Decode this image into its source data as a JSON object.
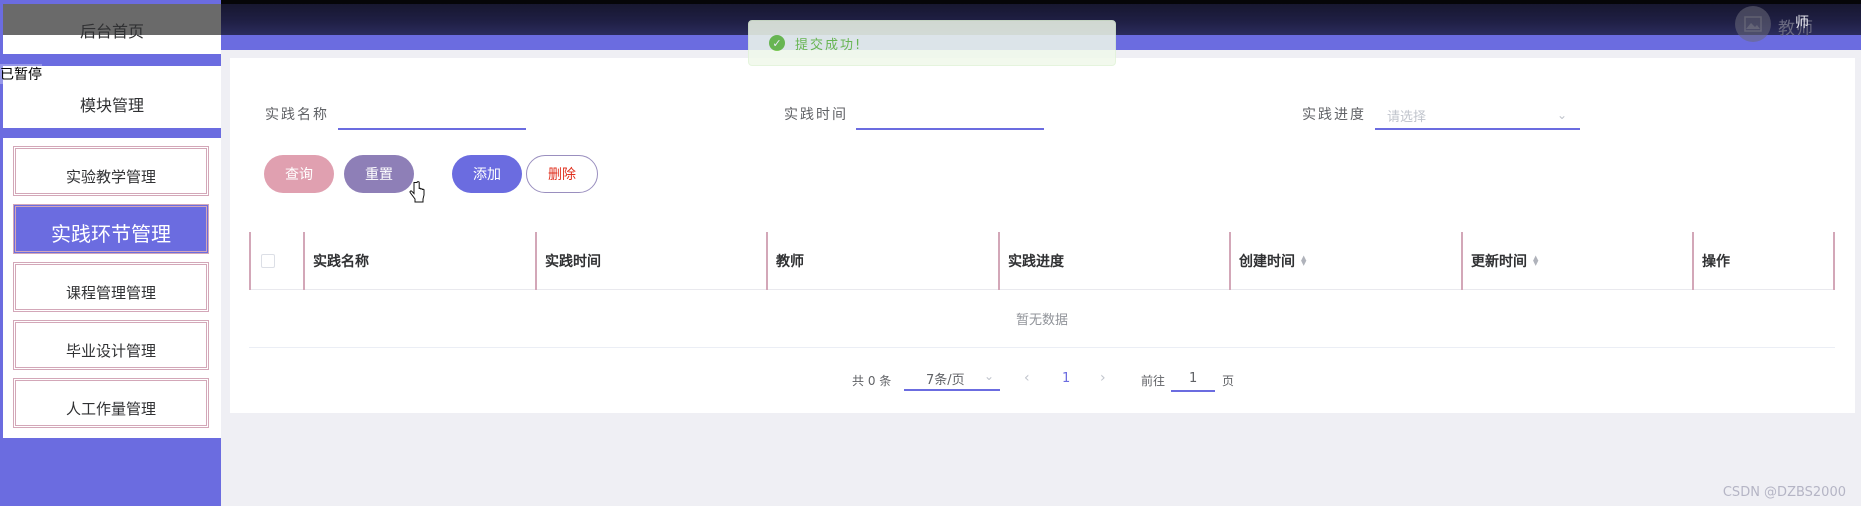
{
  "header": {
    "username": "教师",
    "role_label": "师"
  },
  "sidebar": {
    "home_label": "后台首页",
    "paused_label": "已暂停",
    "module_label": "模块管理",
    "items": [
      {
        "label": "实验教学管理",
        "active": false
      },
      {
        "label": "实践环节管理",
        "active": true
      },
      {
        "label": "课程管理管理",
        "active": false
      },
      {
        "label": "毕业设计管理",
        "active": false
      },
      {
        "label": "人工作量管理",
        "active": false
      }
    ]
  },
  "toast": {
    "message": "提交成功!"
  },
  "search": {
    "name_label": "实践名称",
    "time_label": "实践时间",
    "progress_label": "实践进度",
    "progress_placeholder": "请选择"
  },
  "buttons": {
    "query": "查询",
    "reset": "重置",
    "add": "添加",
    "delete": "删除"
  },
  "table": {
    "columns": [
      "实践名称",
      "实践时间",
      "教师",
      "实践进度",
      "创建时间",
      "更新时间",
      "操作"
    ],
    "empty_text": "暂无数据"
  },
  "pager": {
    "total": "共 0 条",
    "page_size": "7条/页",
    "current_page": "1",
    "goto_label": "前往",
    "goto_value": "1",
    "page_unit": "页"
  },
  "colors": {
    "primary": "#6b6ce0",
    "query_btn": "#e0a0b0",
    "reset_btn": "#8e7fb7",
    "border_accent": "#d3a7b8",
    "success": "#67c23a"
  },
  "watermark": "CSDN @DZBS2000"
}
